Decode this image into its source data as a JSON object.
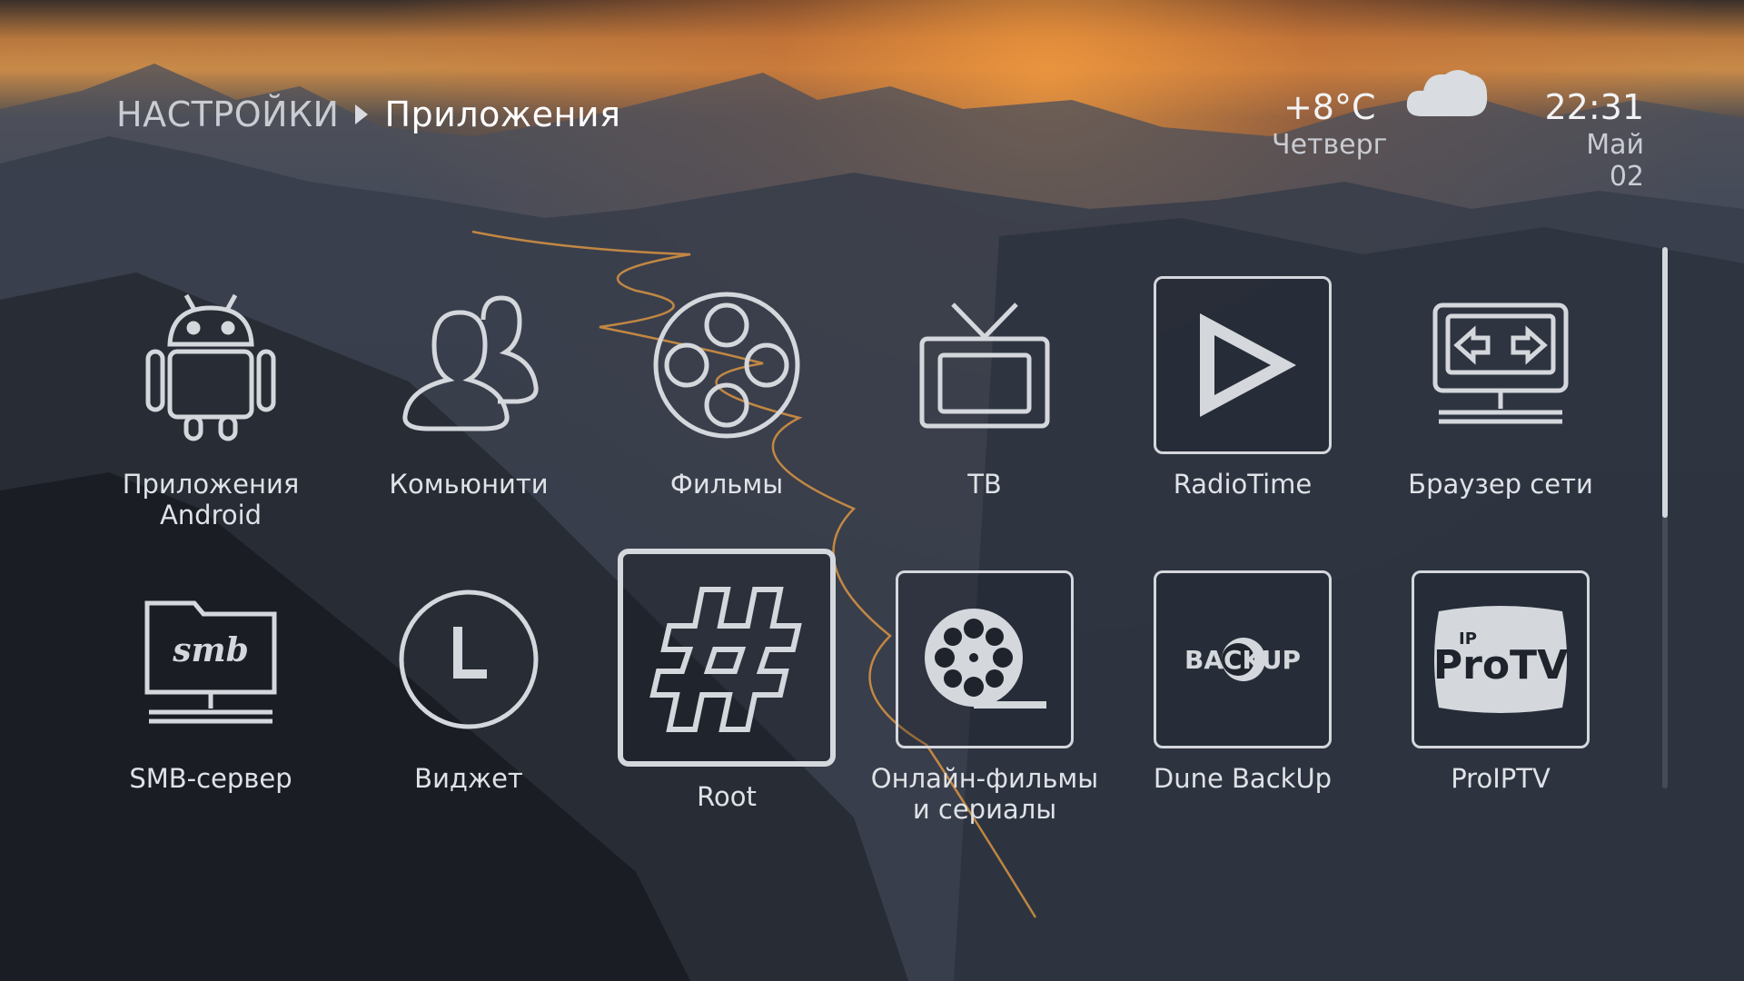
{
  "breadcrumb": {
    "root": "НАСТРОЙКИ",
    "current": "Приложения"
  },
  "weather": {
    "temperature": "+8°C",
    "weekday": "Четверг",
    "icon": "cloud-icon"
  },
  "clock": {
    "time": "22:31",
    "date": "Май 02"
  },
  "apps": [
    {
      "label": "Приложения Android",
      "icon": "android-icon"
    },
    {
      "label": "Комьюнити",
      "icon": "users-icon"
    },
    {
      "label": "Фильмы",
      "icon": "film-reel-icon"
    },
    {
      "label": "ТВ",
      "icon": "tv-icon"
    },
    {
      "label": "RadioTime",
      "icon": "play-icon"
    },
    {
      "label": "Браузер сети",
      "icon": "network-browser-icon"
    },
    {
      "label": "SMB-сервер",
      "icon": "smb-folder-icon"
    },
    {
      "label": "Виджет",
      "icon": "clock-icon"
    },
    {
      "label": "Root",
      "icon": "hash-icon",
      "focused": true
    },
    {
      "label": "Онлайн-фильмы и сериалы",
      "icon": "film-reel-icon"
    },
    {
      "label": "Dune BackUp",
      "icon": "backup-logo-icon",
      "logo_text": "BACKUP"
    },
    {
      "label": "ProIPTV",
      "icon": "proiptv-logo-icon",
      "logo_text": "ProTV",
      "logo_sup": "IP"
    }
  ],
  "scroll": {
    "position": 0.0,
    "visible_fraction": 0.5
  },
  "colors": {
    "icon": "#d4d7dc",
    "text": "#dfe2e6"
  }
}
